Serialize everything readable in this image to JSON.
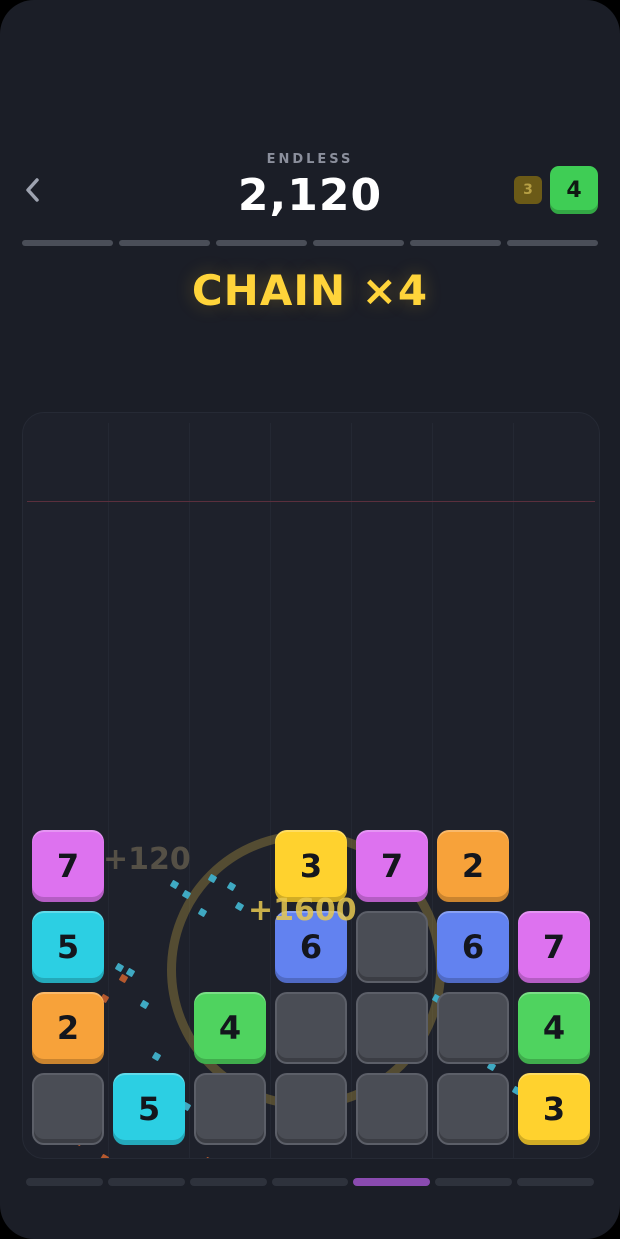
{
  "header": {
    "mode_label": "ENDLESS",
    "score": "2,120",
    "back_icon": "chevron-left-icon"
  },
  "next_queue": {
    "upcoming": "3",
    "current": "4"
  },
  "chain_text": "CHAIN ×4",
  "floating_scores": {
    "small": "+120",
    "large": "+1600"
  },
  "colors": {
    "background": "#1b1e27",
    "board": "#1e212b",
    "accent_yellow": "#ffd43a",
    "tile_1": "#ec6ef1",
    "tile_2": "#f7a23a",
    "tile_3": "#ffd62e",
    "tile_4": "#4fd35f",
    "tile_5": "#2ccfe3",
    "tile_6": "#6a86f4",
    "tile_7": "#d86ee8",
    "empty_tile": "#4a4d55"
  },
  "grid": {
    "columns": 7,
    "rows_visible": 4,
    "tiles": [
      {
        "col": 0,
        "row": 0,
        "value": "7",
        "color": "#dd72ef"
      },
      {
        "col": 3,
        "row": 0,
        "value": "3",
        "color": "#ffd22e"
      },
      {
        "col": 4,
        "row": 0,
        "value": "7",
        "color": "#dd72ef"
      },
      {
        "col": 5,
        "row": 0,
        "value": "2",
        "color": "#f7a23a"
      },
      {
        "col": 0,
        "row": 1,
        "value": "5",
        "color": "#2ccfe3"
      },
      {
        "col": 3,
        "row": 1,
        "value": "6",
        "color": "#6282f0"
      },
      {
        "col": 4,
        "row": 1,
        "value": "",
        "color": "empty"
      },
      {
        "col": 5,
        "row": 1,
        "value": "6",
        "color": "#6282f0"
      },
      {
        "col": 6,
        "row": 1,
        "value": "7",
        "color": "#dd72ef"
      },
      {
        "col": 0,
        "row": 2,
        "value": "2",
        "color": "#f7a23a"
      },
      {
        "col": 2,
        "row": 2,
        "value": "4",
        "color": "#4fd35f"
      },
      {
        "col": 3,
        "row": 2,
        "value": "",
        "color": "empty"
      },
      {
        "col": 4,
        "row": 2,
        "value": "",
        "color": "empty"
      },
      {
        "col": 5,
        "row": 2,
        "value": "",
        "color": "empty"
      },
      {
        "col": 6,
        "row": 2,
        "value": "4",
        "color": "#4fd35f"
      },
      {
        "col": 0,
        "row": 3,
        "value": "",
        "color": "empty"
      },
      {
        "col": 1,
        "row": 3,
        "value": "5",
        "color": "#2ccfe3"
      },
      {
        "col": 2,
        "row": 3,
        "value": "",
        "color": "empty"
      },
      {
        "col": 3,
        "row": 3,
        "value": "",
        "color": "empty"
      },
      {
        "col": 4,
        "row": 3,
        "value": "",
        "color": "empty"
      },
      {
        "col": 5,
        "row": 3,
        "value": "",
        "color": "empty"
      },
      {
        "col": 6,
        "row": 3,
        "value": "3",
        "color": "#ffd22e"
      }
    ]
  },
  "top_progress": {
    "segments": 6,
    "filled": 0
  },
  "bottom_bar": {
    "segments": 7,
    "active_index": 4
  }
}
